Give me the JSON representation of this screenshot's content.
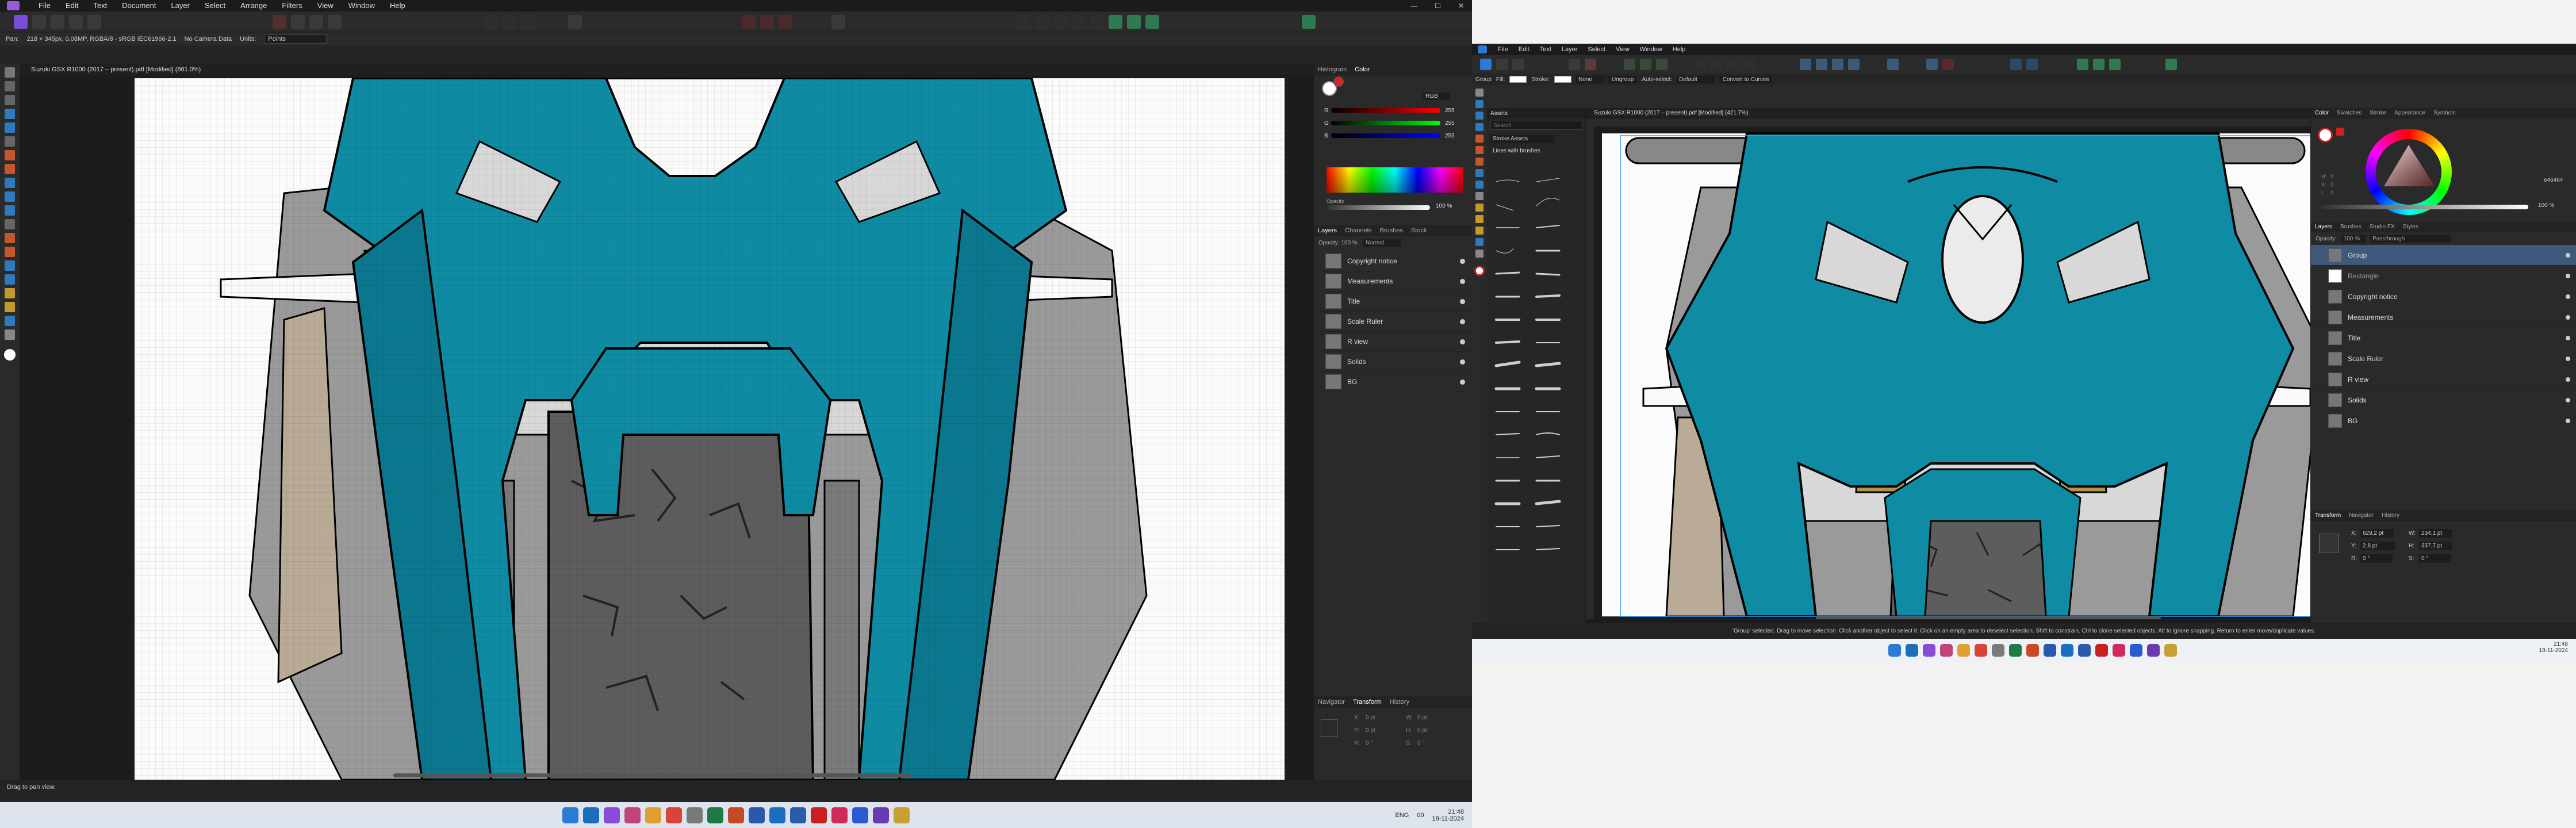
{
  "left": {
    "menu": [
      "File",
      "Edit",
      "Text",
      "Document",
      "Layer",
      "Select",
      "Arrange",
      "Filters",
      "View",
      "Window",
      "Help"
    ],
    "context_bar": {
      "tool_label": "Pan:",
      "info": "218 × 345px, 0.08MP, RGBA/8 - sRGB IEC61966-2.1",
      "camera": "No Camera Data",
      "units_label": "Units:",
      "units_value": "Points"
    },
    "doc_tab": "Suzuki GSX R1000 (2017 – present).pdf [Modified] (861.0%)",
    "panel_tabs_top": [
      "Histogram",
      "Color"
    ],
    "color": {
      "mode": "RGB",
      "channels": [
        {
          "label": "R",
          "value": "255",
          "grad": "linear-gradient(90deg,#000,#f00)"
        },
        {
          "label": "G",
          "value": "255",
          "grad": "linear-gradient(90deg,#000,#0f0)"
        },
        {
          "label": "B",
          "value": "255",
          "grad": "linear-gradient(90deg,#000,#00f)"
        }
      ],
      "opacity_label": "Opacity",
      "opacity_value": "100 %"
    },
    "layers_tabs": [
      "Layers",
      "Channels",
      "Brushes",
      "Stock"
    ],
    "layers_opacity": "Opacity: 100 %",
    "layers_blend": "Normal",
    "layers": [
      "Copyright notice",
      "Measurements",
      "Title",
      "Scale Ruler",
      "R view",
      "Solids",
      "BG"
    ],
    "bottom_tabs": [
      "Navigator",
      "Transform",
      "History"
    ],
    "transform": {
      "x_label": "X:",
      "x": "0 pt",
      "y_label": "Y:",
      "y": "0 pt",
      "w_label": "W:",
      "w": "0 pt",
      "h_label": "H:",
      "h": "0 pt",
      "r_label": "R:",
      "r": "0 °",
      "s_label": "S:",
      "s": "0 °"
    },
    "status": "Drag to pan view.",
    "taskbar_time": "21:48",
    "taskbar_date": "18-11-2024",
    "taskbar_lang": "ENG",
    "taskbar_num": "00"
  },
  "right": {
    "menu": [
      "File",
      "Edit",
      "Text",
      "Layer",
      "Select",
      "View",
      "Window",
      "Help"
    ],
    "context_bar": {
      "group": "Group",
      "fill_label": "Fill:",
      "stroke_label": "Stroke:",
      "stroke_none": "None",
      "ungroup": "Ungroup",
      "autoselect_label": "Auto-select:",
      "autoselect_value": "Default",
      "convert": "Convert to Curves"
    },
    "doc_tab": "Suzuki GSX R1000 (2017 – present).pdf [Modified] (421.7%)",
    "assets": {
      "title": "Assets",
      "search_placeholder": "Search",
      "category": "Stroke Assets",
      "group": "Lines with brushes"
    },
    "color_tabs": [
      "Color",
      "Swatches",
      "Stroke",
      "Appearance",
      "Symbols"
    ],
    "color_hex": "e46464",
    "color_h_label": "H:",
    "color_h": "0",
    "color_s_label": "S:",
    "color_s": "0",
    "color_l_label": "L:",
    "color_l": "0",
    "opacity_value": "100 %",
    "layers_tabs": [
      "Layers",
      "Brushes",
      "Studio FX",
      "Styles"
    ],
    "layers_opacity": "Opacity:",
    "layers_opacity_value": "100 %",
    "layers_blend": "Passthrough",
    "layers": [
      "Group",
      "Rectangle",
      "Copyright notice",
      "Measurements",
      "Title",
      "Scale Ruler",
      "R view",
      "Solids",
      "BG"
    ],
    "bottom_tabs": [
      "Transform",
      "Navigator",
      "History"
    ],
    "transform": {
      "x_label": "X:",
      "x": "629,2 pt",
      "w_label": "W:",
      "w": "234,1 pt",
      "y_label": "Y:",
      "y": "2,8 pt",
      "h_label": "H:",
      "h": "337,7 pt",
      "r_label": "R:",
      "r": "0 °",
      "s_label": "S:",
      "s": "0 °"
    },
    "status": "'Group' selected. Drag to move selection. Click another object to select it. Click on an empty area to deselect selection. Shift to constrain. Ctrl to clone selected objects. Alt to ignore snapping. Return to enter move/duplicate values.",
    "taskbar_time": "21:48",
    "taskbar_date": "18-11-2024"
  },
  "colors": {
    "teal": "#0f8ba3",
    "teal_dark": "#0b6f84",
    "ochre": "#b59447",
    "tire": "#5d5d5d",
    "gray": "#9a9a9a",
    "light": "#d8d8d8",
    "beige": "#b9ab95",
    "accent": "#7a4cd8",
    "task_left": "#dde4ee",
    "task_right": "#eef2f7"
  }
}
